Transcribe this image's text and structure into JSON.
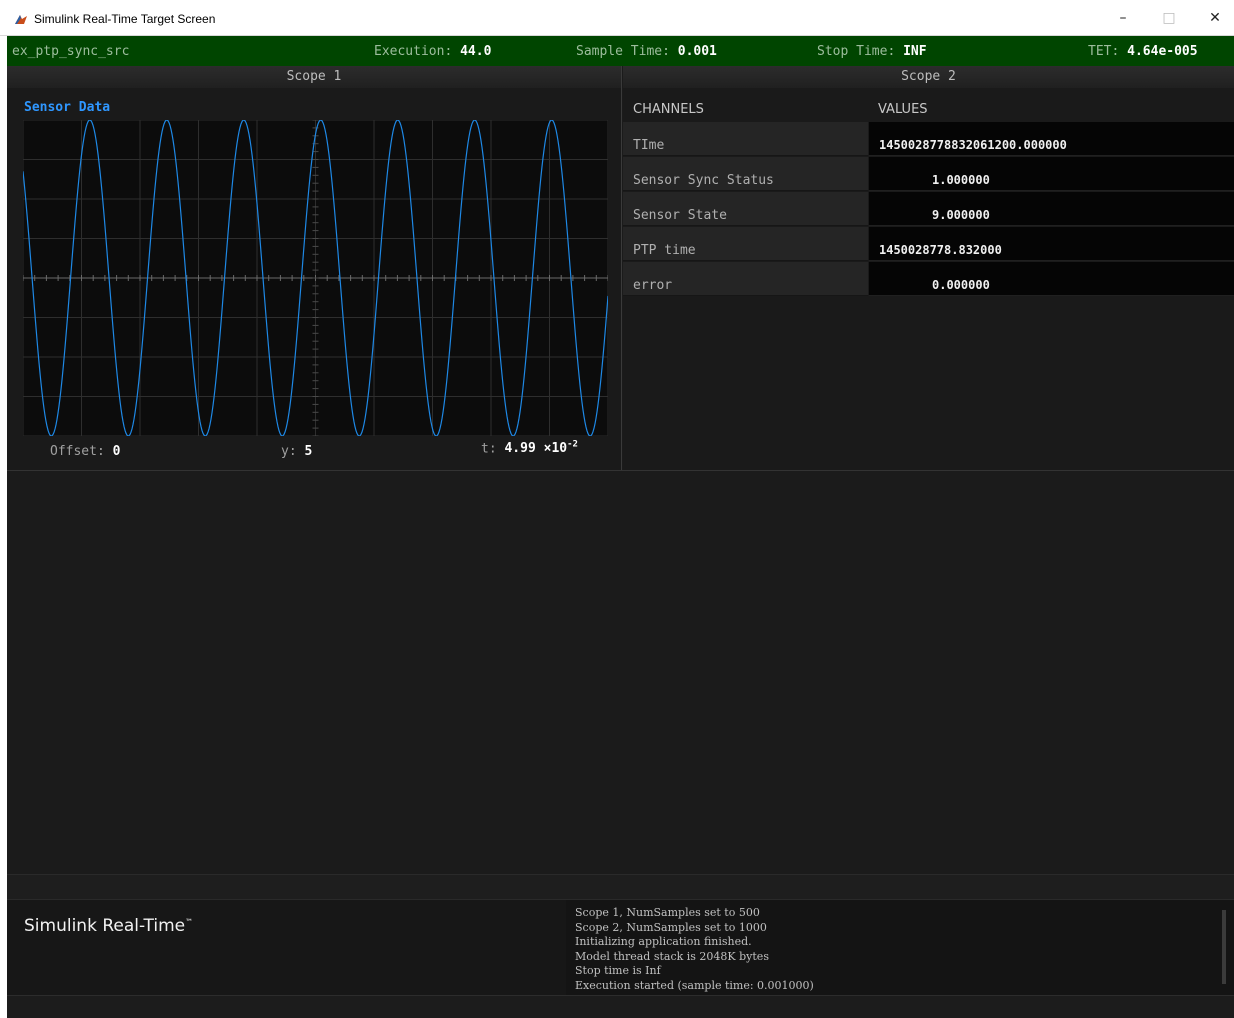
{
  "window": {
    "title": "Simulink Real-Time Target Screen",
    "controls": {
      "minimize": "–",
      "maximize": "□",
      "close": "✕"
    }
  },
  "status": {
    "app_name": "ex_ptp_sync_src",
    "execution_label": "Execution:",
    "execution_value": "44.0",
    "sample_time_label": "Sample Time:",
    "sample_time_value": "0.001",
    "stop_time_label": "Stop Time:",
    "stop_time_value": "INF",
    "tet_label": "TET:",
    "tet_value": "4.64e-005"
  },
  "scope1": {
    "header": "Scope 1",
    "signal_title": "Sensor Data",
    "offset_label": "Offset:",
    "offset_value": "0",
    "y_label": "y:",
    "y_value": "5",
    "t_label": "t:",
    "t_mantissa": "4.99",
    "t_times": "×10",
    "t_exponent": "-2",
    "trace_color": "#1e88e5",
    "trace_periods": 7.6,
    "trace_amplitude": 0.5,
    "trace_phase": 2.4
  },
  "scope2": {
    "header": "Scope 2",
    "col_channels": "CHANNELS",
    "col_values": "VALUES",
    "rows": [
      {
        "channel": "TIme",
        "value": "1450028778832061200.000000"
      },
      {
        "channel": "Sensor Sync Status",
        "value": "1.000000"
      },
      {
        "channel": "Sensor State",
        "value": "9.000000"
      },
      {
        "channel": "PTP time",
        "value": "1450028778.832000"
      },
      {
        "channel": "error",
        "value": "0.000000"
      }
    ]
  },
  "footer": {
    "brand": "Simulink Real-Time",
    "brand_tm": "™",
    "log": [
      "Scope 1, NumSamples set to 500",
      "Scope 2, NumSamples set to 1000",
      "Initializing application finished.",
      "Model thread stack is 2048K bytes",
      "Stop time is Inf",
      "Execution started (sample time: 0.001000)"
    ]
  },
  "colors": {
    "status_bg": "#004500",
    "signal_title": "#2f97ff"
  }
}
